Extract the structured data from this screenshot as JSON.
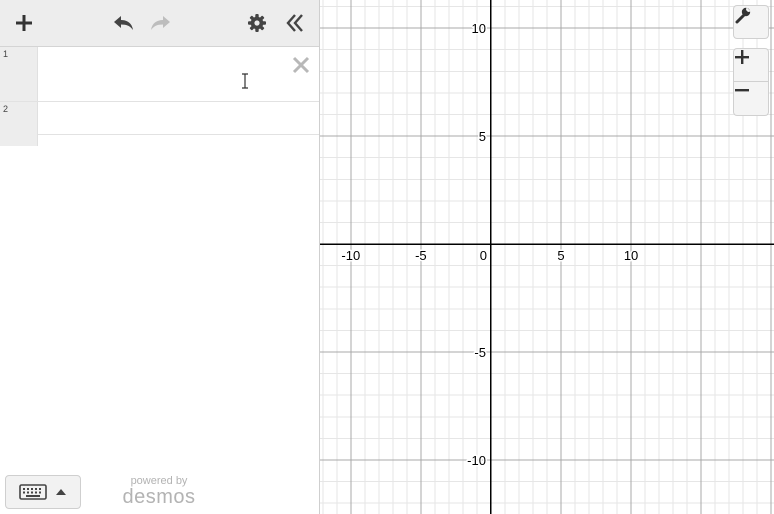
{
  "topbar": {
    "add_icon": "plus-icon",
    "undo_icon": "undo-icon",
    "redo_icon": "redo-icon",
    "settings_icon": "gear-icon",
    "collapse_icon": "double-chevron-left-icon"
  },
  "expressions": [
    {
      "index": "1",
      "value": ""
    },
    {
      "index": "2",
      "value": ""
    }
  ],
  "footer": {
    "keyboard_icon": "keyboard-icon",
    "powered_by": "powered by",
    "brand": "desmos"
  },
  "graph_controls": {
    "settings_icon": "wrench-icon",
    "zoom_in_icon": "plus-icon",
    "zoom_out_icon": "minus-icon"
  },
  "graph": {
    "x_range": [
      -12.2,
      20.2
    ],
    "y_range": [
      -12.5,
      11.3
    ],
    "minor_step": 1,
    "major_step": 5,
    "x_ticks": [
      {
        "value": -10,
        "label": "-10"
      },
      {
        "value": -5,
        "label": "-5"
      },
      {
        "value": 0,
        "label": "0"
      },
      {
        "value": 5,
        "label": "5"
      },
      {
        "value": 10,
        "label": "10"
      }
    ],
    "y_ticks": [
      {
        "value": 10,
        "label": "10"
      },
      {
        "value": 5,
        "label": "5"
      },
      {
        "value": -5,
        "label": "-5"
      },
      {
        "value": -10,
        "label": "-10"
      }
    ],
    "colors": {
      "minor": "#e6e6e6",
      "major": "#a8a8a8",
      "axis": "#000000"
    }
  }
}
